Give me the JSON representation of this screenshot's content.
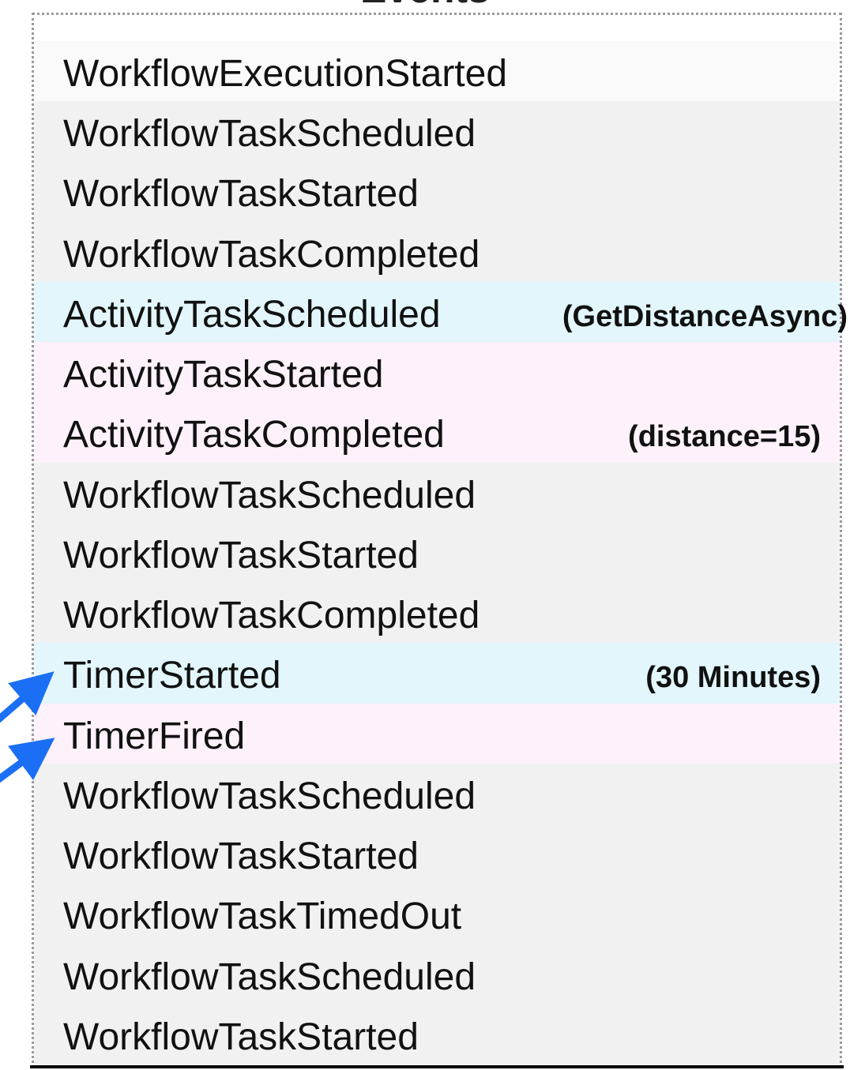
{
  "title": "Events",
  "colors": {
    "default": "#f1f1f1",
    "first": "#fafafa",
    "scheduled": "#e2f6fc",
    "completed": "#fdf1fb",
    "arrow": "#1a6ff5"
  },
  "events": [
    {
      "label": "WorkflowExecutionStarted",
      "note": "",
      "kind": "first"
    },
    {
      "label": "WorkflowTaskScheduled",
      "note": "",
      "kind": "default"
    },
    {
      "label": "WorkflowTaskStarted",
      "note": "",
      "kind": "default"
    },
    {
      "label": "WorkflowTaskCompleted",
      "note": "",
      "kind": "default"
    },
    {
      "label": "ActivityTaskScheduled",
      "note": "(GetDistanceAsync)",
      "kind": "scheduled"
    },
    {
      "label": "ActivityTaskStarted",
      "note": "",
      "kind": "completed"
    },
    {
      "label": "ActivityTaskCompleted",
      "note": "(distance=15)",
      "kind": "completed"
    },
    {
      "label": "WorkflowTaskScheduled",
      "note": "",
      "kind": "default"
    },
    {
      "label": "WorkflowTaskStarted",
      "note": "",
      "kind": "default"
    },
    {
      "label": "WorkflowTaskCompleted",
      "note": "",
      "kind": "default"
    },
    {
      "label": "TimerStarted",
      "note": "(30 Minutes)",
      "kind": "scheduled"
    },
    {
      "label": "TimerFired",
      "note": "",
      "kind": "completed"
    },
    {
      "label": "WorkflowTaskScheduled",
      "note": "",
      "kind": "default"
    },
    {
      "label": "WorkflowTaskStarted",
      "note": "",
      "kind": "default"
    },
    {
      "label": "WorkflowTaskTimedOut",
      "note": "",
      "kind": "default"
    },
    {
      "label": "WorkflowTaskScheduled",
      "note": "",
      "kind": "default"
    },
    {
      "label": "WorkflowTaskStarted",
      "note": "",
      "kind": "default"
    }
  ]
}
